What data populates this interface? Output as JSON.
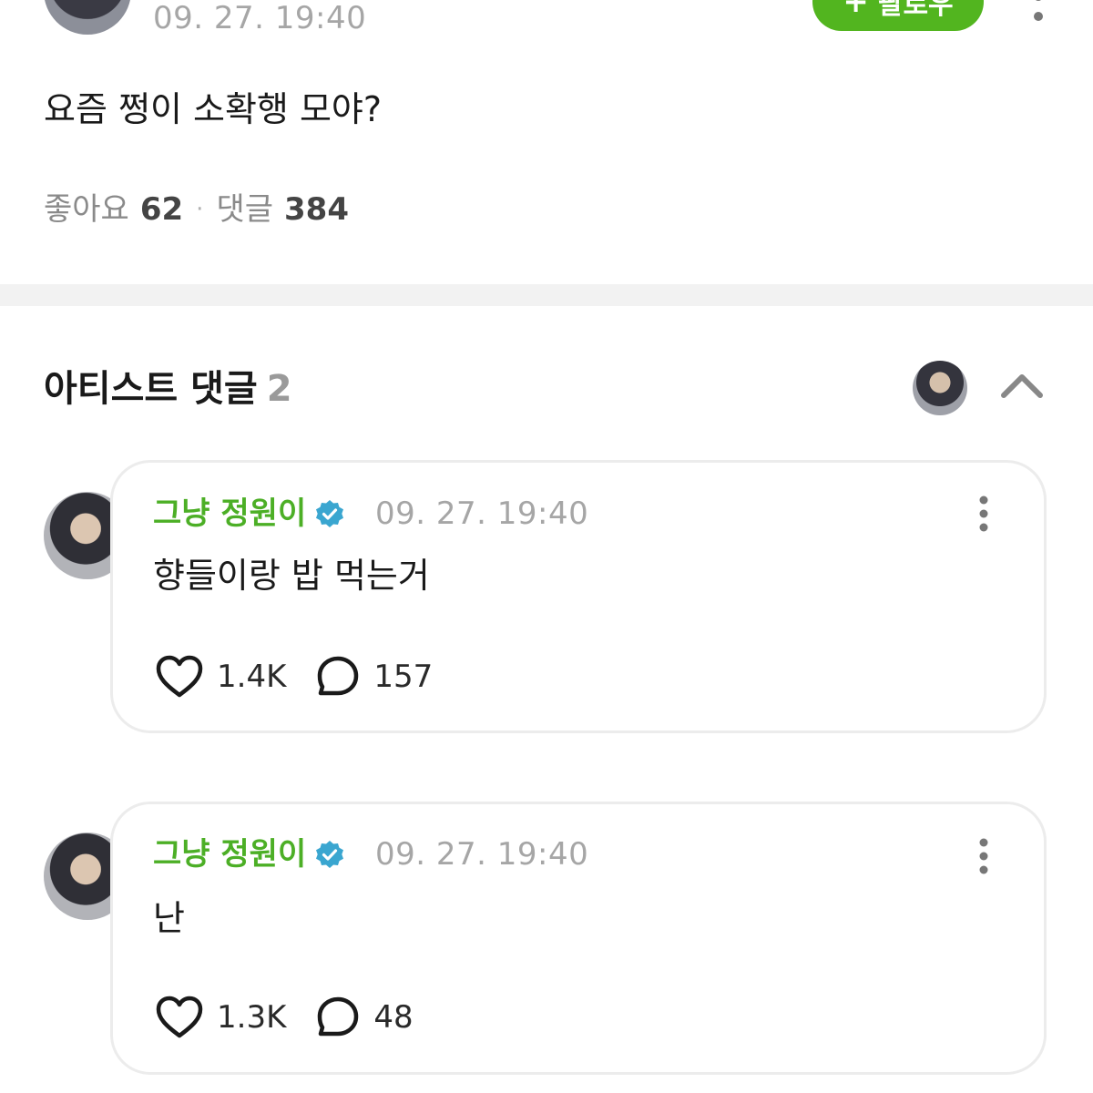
{
  "post": {
    "time": "09. 27. 19:40",
    "follow_label": "팔로우",
    "text": "요즘 쩡이 소확행 모야?",
    "likes_label": "좋아요",
    "likes_count": "62",
    "comments_label": "댓글",
    "comments_count": "384"
  },
  "artist_comments": {
    "title": "아티스트 댓글",
    "count": "2",
    "items": [
      {
        "name": "그냥 정원이",
        "time": "09. 27. 19:40",
        "text": "향들이랑 밥 먹는거",
        "likes": "1.4K",
        "replies": "157"
      },
      {
        "name": "그냥 정원이",
        "time": "09. 27. 19:40",
        "text": "난",
        "likes": "1.3K",
        "replies": "48"
      }
    ]
  },
  "colors": {
    "accent_green": "#52b51f",
    "name_green": "#4caf26",
    "verified_blue": "#3aa6d0",
    "muted_text": "#a6a6a6",
    "divider": "#f2f2f2"
  },
  "icons": [
    "more-vertical-icon",
    "plus-icon",
    "chevron-up-icon",
    "verified-badge-icon",
    "heart-icon",
    "comment-bubble-icon"
  ]
}
